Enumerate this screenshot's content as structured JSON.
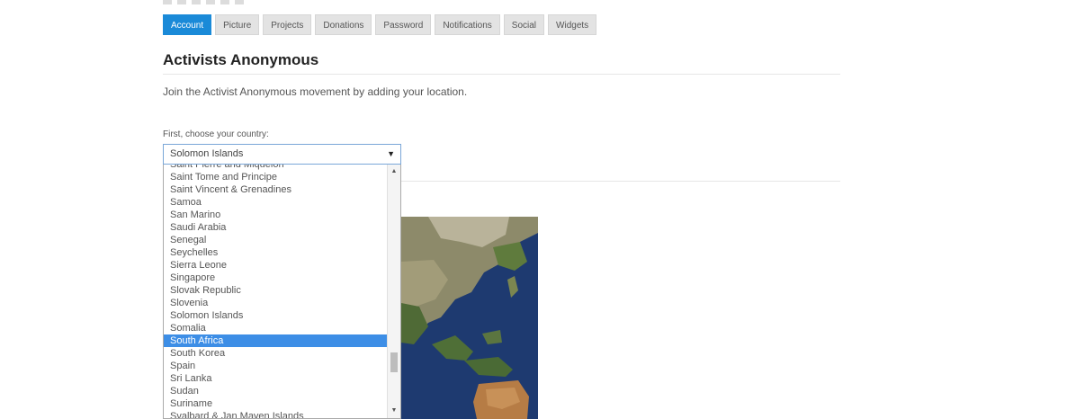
{
  "tabs": [
    {
      "label": "Account",
      "active": true
    },
    {
      "label": "Picture",
      "active": false
    },
    {
      "label": "Projects",
      "active": false
    },
    {
      "label": "Donations",
      "active": false
    },
    {
      "label": "Password",
      "active": false
    },
    {
      "label": "Notifications",
      "active": false
    },
    {
      "label": "Social",
      "active": false
    },
    {
      "label": "Widgets",
      "active": false
    }
  ],
  "section": {
    "title": "Activists Anonymous",
    "intro": "Join the Activist Anonymous movement by adding your location."
  },
  "country_field": {
    "label": "First, choose your country:",
    "value": "Solomon Islands",
    "caret": "▼"
  },
  "dropdown": {
    "options": [
      "Saint Pierre and Miquelon",
      "Saint Tome and Principe",
      "Saint Vincent & Grenadines",
      "Samoa",
      "San Marino",
      "Saudi Arabia",
      "Senegal",
      "Seychelles",
      "Sierra Leone",
      "Singapore",
      "Slovak Republic",
      "Slovenia",
      "Solomon Islands",
      "Somalia",
      "South Africa",
      "South Korea",
      "Spain",
      "Sri Lanka",
      "Sudan",
      "Suriname",
      "Svalbard & Jan Mayen Islands"
    ],
    "highlighted": "South Africa",
    "scroll_up": "▲",
    "scroll_down": "▼"
  },
  "colors": {
    "accent": "#1a8ad8",
    "highlight": "#3d8ee6"
  }
}
